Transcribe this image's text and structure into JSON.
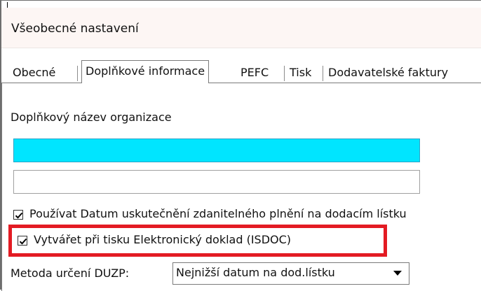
{
  "window": {
    "title": "Všeobecné nastavení"
  },
  "tabs": [
    {
      "label": "Obecné",
      "active": false
    },
    {
      "label": "Doplňkové informace",
      "active": true
    },
    {
      "label": "PEFC",
      "active": false
    },
    {
      "label": "Tisk",
      "active": false
    },
    {
      "label": "Dodavatelské faktury",
      "active": false
    }
  ],
  "form": {
    "org_name_label": "Doplňkový název organizace",
    "org_name_line1": "",
    "org_name_line2": "",
    "use_duzp_checkbox": {
      "label": "Používat Datum uskutečnění zdanitelného plnění na dodacím lístku",
      "checked": true
    },
    "isdoc_checkbox": {
      "label": "Vytvářet při tisku Elektronický doklad (ISDOC)",
      "checked": true
    },
    "duzp_method": {
      "label": "Metoda určení DUZP:",
      "value": "Nejnižší datum na dod.lístku"
    }
  },
  "colors": {
    "highlight": "#e31b23",
    "focused_field": "#00e5ff"
  }
}
